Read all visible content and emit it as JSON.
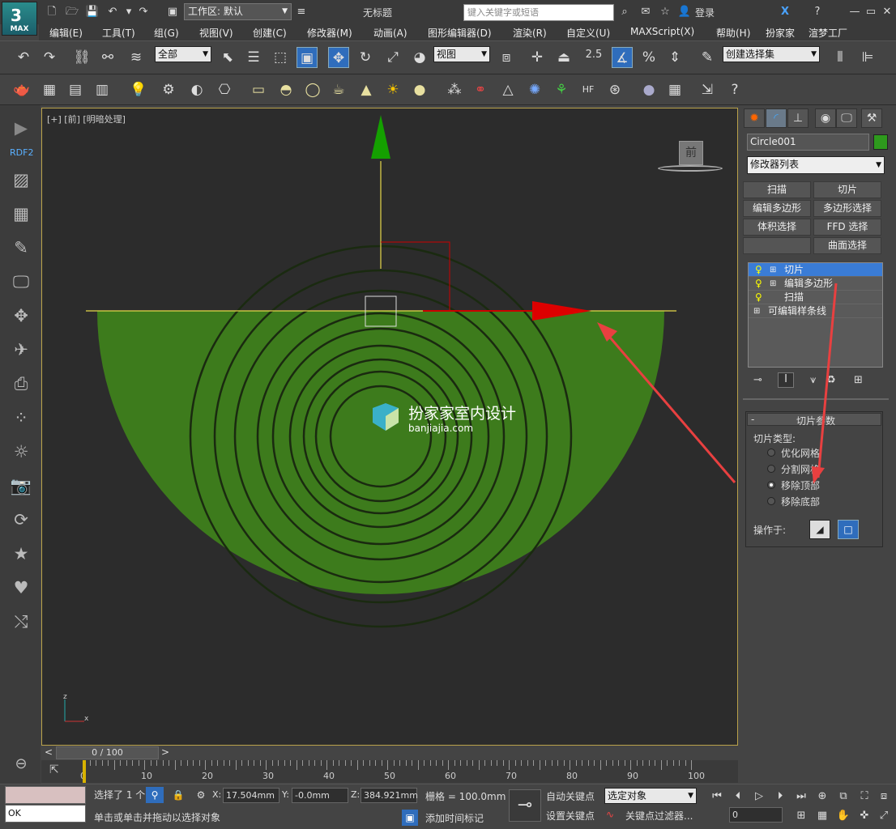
{
  "app": {
    "logo_text": "MAX",
    "workspace": "工作区: 默认",
    "doc_title": "无标题",
    "search_placeholder": "键入关键字或短语",
    "login": "登录"
  },
  "menu": [
    "编辑(E)",
    "工具(T)",
    "组(G)",
    "视图(V)",
    "创建(C)",
    "修改器(M)",
    "动画(A)",
    "图形编辑器(D)",
    "渲染(R)",
    "自定义(U)",
    "MAXScript(X)",
    "帮助(H)",
    "扮家家",
    "渲梦工厂"
  ],
  "toolbar": {
    "selection_filter": "全部",
    "ref_coord": "视图",
    "snap_angle": "2.5",
    "named_selection": "创建选择集"
  },
  "left_sidebar": {
    "label": "RDF2"
  },
  "viewport": {
    "label": "[+] [前] [明暗处理]",
    "viewcube_label": "前",
    "watermark_title": "扮家家室内设计",
    "watermark_url": "banjiajia.com",
    "axis_z": "z",
    "axis_x": "x"
  },
  "panel": {
    "object_name": "Circle001",
    "object_color": "#2e9a1d",
    "modifier_list": "修改器列表",
    "buttons": [
      "扫描",
      "切片",
      "编辑多边形",
      "多边形选择",
      "体积选择",
      "FFD 选择",
      "",
      "曲面选择"
    ],
    "stack": [
      {
        "label": "切片",
        "selected": true
      },
      {
        "label": "编辑多边形",
        "selected": false
      },
      {
        "label": "扫描",
        "selected": false
      },
      {
        "label": "可编辑样条线",
        "selected": false
      }
    ],
    "rollout_title": "切片参数",
    "rollout_minus": "-",
    "slice_type_label": "切片类型:",
    "slice_types": [
      {
        "label": "优化网格",
        "selected": false
      },
      {
        "label": "分割网格",
        "selected": false
      },
      {
        "label": "移除顶部",
        "selected": true
      },
      {
        "label": "移除底部",
        "selected": false
      }
    ],
    "operate_on_label": "操作于:"
  },
  "timeline": {
    "frame": "0 / 100",
    "ticks": [
      "0",
      "10",
      "20",
      "30",
      "40",
      "50",
      "60",
      "70",
      "80",
      "90",
      "100"
    ],
    "prev": "<",
    "next": ">"
  },
  "status": {
    "swatch_text": "OK",
    "selected": "选择了 1 个",
    "x_label": "X:",
    "x_value": "17.504mm",
    "y_label": "Y:",
    "y_value": "-0.0mm",
    "z_label": "Z:",
    "z_value": "384.921mm",
    "grid": "栅格 = 100.0mm",
    "prompt": "单击或单击并拖动以选择对象",
    "add_time_tag": "添加时间标记",
    "auto_key": "自动关键点",
    "set_key": "设置关键点",
    "key_mode": "选定对象",
    "key_filter": "关键点过滤器...",
    "frame_field": "0"
  },
  "colors": {
    "mesh": "#3a7a1a",
    "gizmo_x": "#cc0000",
    "gizmo_y": "#00a000",
    "select": "#2f6dbc",
    "annotation": "#e84040"
  }
}
